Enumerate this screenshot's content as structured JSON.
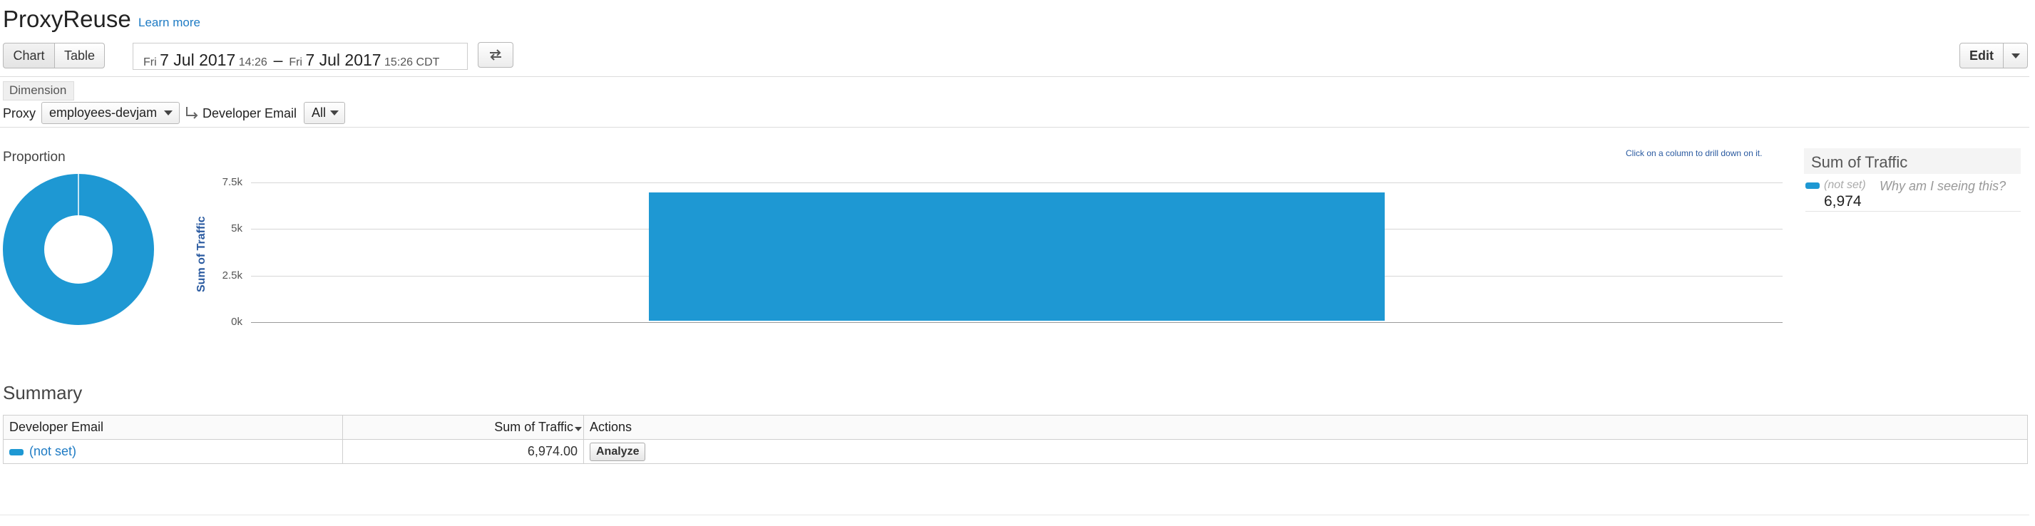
{
  "header": {
    "title": "ProxyReuse",
    "learn_more": "Learn more"
  },
  "toolbar": {
    "chart_tab": "Chart",
    "table_tab": "Table",
    "date_range": {
      "from_day": "Fri",
      "from_date": "7 Jul 2017",
      "from_time": "14:26",
      "separator": "–",
      "to_day": "Fri",
      "to_date": "7 Jul 2017",
      "to_time": "15:26 CDT"
    },
    "swap_icon": "swap-arrows-icon",
    "edit_label": "Edit"
  },
  "dimension": {
    "tag": "Dimension",
    "proxy_label": "Proxy",
    "proxy_value": "employees-devjam",
    "drill_icon": "drilldown-arrow-icon",
    "developer_email_label": "Developer Email",
    "developer_email_value": "All"
  },
  "proportion": {
    "title": "Proportion"
  },
  "chart_hint": "Click on a column to drill down on it.",
  "chart_data": [
    {
      "type": "pie",
      "labels": [
        "(not set)"
      ],
      "values": [
        6974
      ],
      "colors": [
        "#1e98d3"
      ]
    },
    {
      "type": "bar",
      "categories": [
        "(not set)"
      ],
      "values": [
        6974
      ],
      "ylabel": "Sum of Traffic",
      "ylim": [
        0,
        7500
      ],
      "yticks": [
        "0k",
        "2.5k",
        "5k",
        "7.5k"
      ],
      "ytick_values": [
        0,
        2500,
        5000,
        7500
      ],
      "grid": true,
      "color": "#1e98d3"
    }
  ],
  "legend": {
    "title": "Sum of Traffic",
    "item_label": "(not set)",
    "why_link": "Why am I seeing this?",
    "item_value": "6,974"
  },
  "summary": {
    "title": "Summary",
    "columns": [
      "Developer Email",
      "Sum of Traffic",
      "Actions"
    ],
    "rows": [
      {
        "email": "(not set)",
        "traffic": "6,974.00",
        "action": "Analyze"
      }
    ]
  },
  "colors": {
    "accent": "#1e98d3",
    "link": "#1e7bc4"
  }
}
